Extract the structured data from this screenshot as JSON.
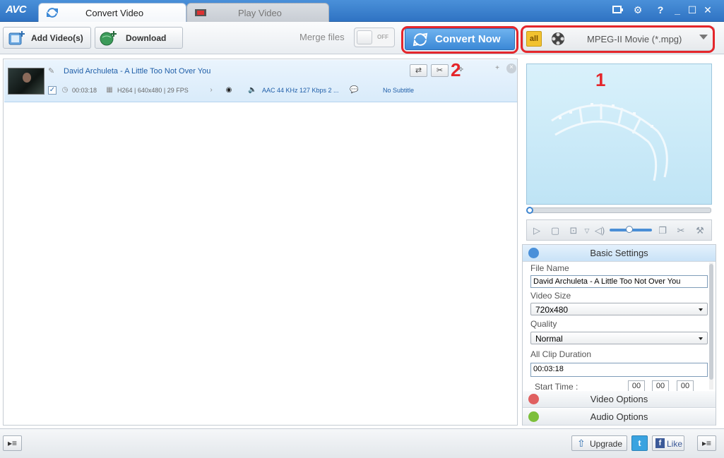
{
  "app": {
    "logo": "AVC"
  },
  "tabs": [
    {
      "label": "Convert Video",
      "active": true
    },
    {
      "label": "Play Video",
      "active": false
    }
  ],
  "toolbar": {
    "add_videos": "Add Video(s)",
    "download": "Download",
    "merge_label": "Merge files",
    "merge_state": "OFF",
    "convert_now": "Convert Now"
  },
  "format": {
    "badge": "all",
    "selected": "MPEG-II Movie (*.mpg)"
  },
  "annotations": {
    "one": "1",
    "two": "2"
  },
  "file": {
    "title": "David Archuleta - A Little Too Not Over You",
    "duration": "00:03:18",
    "video_info": "H264 | 640x480 | 29 FPS",
    "audio_info": "AAC 44 KHz 127 Kbps 2 ...",
    "subtitle": "No Subtitle"
  },
  "settings": {
    "header": "Basic Settings",
    "file_name_label": "File Name",
    "file_name_value": "David Archuleta - A Little Too Not Over You",
    "video_size_label": "Video Size",
    "video_size_value": "720x480",
    "quality_label": "Quality",
    "quality_value": "Normal",
    "all_clip_label": "All Clip Duration",
    "all_clip_value": "00:03:18",
    "start_time_label": "Start Time :",
    "start_h": "00",
    "start_m": "00",
    "start_s": "00",
    "video_options": "Video Options",
    "audio_options": "Audio Options"
  },
  "statusbar": {
    "upgrade": "Upgrade",
    "like": "Like"
  },
  "colors": {
    "accent": "#3b88d6",
    "annotation": "#e4262b",
    "title_link": "#1f5ea8"
  }
}
